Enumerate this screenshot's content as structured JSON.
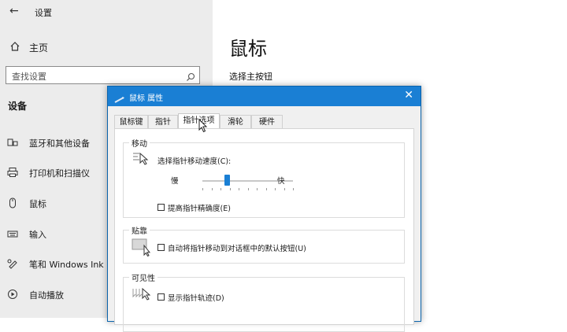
{
  "app": {
    "title": "设置"
  },
  "sidebar": {
    "home": "主页",
    "search_placeholder": "查找设置",
    "section": "设备",
    "items": [
      {
        "label": "蓝牙和其他设备",
        "icon": "bluetooth-devices-icon"
      },
      {
        "label": "打印机和扫描仪",
        "icon": "printer-icon"
      },
      {
        "label": "鼠标",
        "icon": "mouse-icon"
      },
      {
        "label": "输入",
        "icon": "keyboard-icon"
      },
      {
        "label": "笔和 Windows Ink",
        "icon": "pen-icon"
      },
      {
        "label": "自动播放",
        "icon": "autoplay-icon"
      }
    ]
  },
  "main": {
    "title": "鼠标",
    "primary_button_label": "选择主按钮"
  },
  "dialog": {
    "title": "鼠标 属性",
    "tabs": [
      "鼠标键",
      "指针",
      "指针选项",
      "滑轮",
      "硬件"
    ],
    "active_tab": "指针选项",
    "motion": {
      "group_title": "移动",
      "speed_label": "选择指针移动速度(C):",
      "slow": "慢",
      "fast": "快",
      "speed_fraction": 0.27,
      "precision_label": "提高指针精确度(E)",
      "precision_checked": false
    },
    "snap": {
      "group_title": "贴靠",
      "label": "自动将指针移动到对话框中的默认按钮(U)",
      "checked": false
    },
    "visibility": {
      "group_title": "可见性",
      "trails_label": "显示指针轨迹(D)",
      "trails_checked": false
    }
  },
  "colors": {
    "accent": "#1a7fd4",
    "sidebar_bg": "#ececec",
    "dialog_bg": "#f0f0f0"
  }
}
